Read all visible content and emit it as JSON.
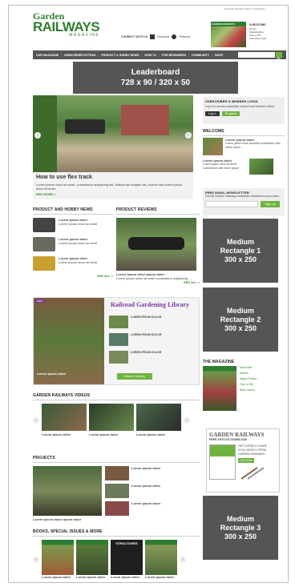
{
  "logo": {
    "line1": "Garden",
    "line2": "RAILWAYS",
    "line3": "MAGAZINE"
  },
  "top_links": "Customer Service | Help | Contributors",
  "connect": {
    "label": "CONNECT WITH US",
    "facebook": "Facebook",
    "pinterest": "Pinterest"
  },
  "subscribe": {
    "title": "SUBSCRIBE",
    "lines": [
      "Renew",
      "Digital Edition",
      "Give a Gift",
      "Subscriber Help"
    ]
  },
  "nav": {
    "items": [
      "OUR MAGAZINE",
      "SUBSCRIBER EXTRAS",
      "PRODUCT & HOBBY NEWS",
      "HOW TO",
      "FOR BEGINNERS",
      "COMMUNITY",
      "SHOP"
    ],
    "search_placeholder": ""
  },
  "ads": {
    "leaderboard": {
      "line1": "Leaderboard",
      "line2": "728 x 90 / 320 x 50"
    },
    "rect1": {
      "line1": "Medium",
      "line2": "Rectangle 1",
      "line3": "300 x 250"
    },
    "rect2": {
      "line1": "Medium",
      "line2": "Rectangle 2",
      "line3": "300 x 250"
    },
    "rect3": {
      "line1": "Medium",
      "line2": "Rectangle 3",
      "line3": "300 x 250"
    }
  },
  "hero": {
    "title": "How to use flex track",
    "body": "Lorem ipsum dolor sit amet, consectetur adipiscing elit. Maecenas magna nisl, viverra sed lorem ipsum dolor sit amet.",
    "more": "SEE MORE »"
  },
  "login": {
    "title": "SUBSCRIBER & MEMBER LOGIN",
    "body": "Log in to access subscriber content and member extras.",
    "login_btn": "Log in",
    "register_btn": "Register"
  },
  "welcome": {
    "title": "WELCOME",
    "items": [
      "Lorem ipsum dolor",
      "Lorem ipsum dolor"
    ],
    "body": "Lorem ipsum dolor sit amet consectetur with lorem ipsum"
  },
  "newsletter": {
    "title": "FREE EMAIL NEWSLETTER",
    "body": "Get the Garden Railways newsletter delivered to your inbox.",
    "signup": "Sign up"
  },
  "product_news": {
    "title": "PRODUCT AND HOBBY NEWS",
    "items": [
      "Lorem ipsum dolor",
      "Lorem ipsum dolor",
      "Lorem ipsum dolor"
    ],
    "body": "Lorem ipsum dolor sit amet",
    "more": "SEE ALL »"
  },
  "product_reviews": {
    "title": "PRODUCT REVIEWS",
    "caption": "Lorem ipsum dolor ipsum dolor",
    "body": "Lorem ipsum dolor sit amet consectetur adipiscing",
    "more": "SEE ALL »"
  },
  "library": {
    "badge": "NEW",
    "title": "Railroad Gardening Library",
    "items": [
      "LOREM IPSUM DOLOR",
      "LOREM IPSUM DOLOR",
      "LOREM IPSUM DOLOR"
    ],
    "caption": "Lorem ipsum dolor",
    "button": "Search Library"
  },
  "magazine": {
    "title": "THE MAGAZINE",
    "items": [
      "Subscribe",
      "Renew",
      "Digital Edition",
      "Give a Gift",
      "Back Issues"
    ]
  },
  "free_download": {
    "title": "GARDEN RAILWAYS",
    "subtitle": "FREE ARTICLE DOWNLOAD",
    "body": "GET A FREE E-GUIDE EXCLUSIVELY FROM GARDEN RAILWAYS",
    "button": "Get Now"
  },
  "videos": {
    "title": "GARDEN RAILWAYS VIDEOS",
    "captions": [
      "Lorem ipsum dolor",
      "Lorem ipsum dolor",
      "Lorem ipsum dolor"
    ]
  },
  "projects": {
    "title": "PROJECTS",
    "caption": "Lorem ipsum dolor ipsum dolor",
    "items": [
      "Lorem ipsum dolor",
      "Lorem ipsum dolor",
      "Lorem ipsum dolor"
    ]
  },
  "books": {
    "title": "BOOKS, SPECIAL ISSUES & MORE",
    "captions": [
      "Lorem ipsum dolor",
      "Lorem ipsum dolor",
      "Lorem ipsum dolor",
      "Lorem ipsum dolor"
    ],
    "cover3": "STRUCTURES"
  }
}
